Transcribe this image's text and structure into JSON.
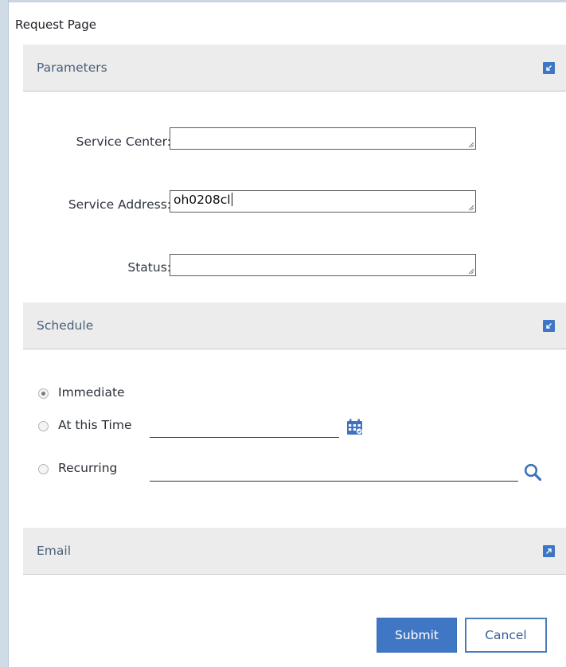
{
  "page": {
    "title": "Request Page"
  },
  "sections": {
    "parameters": {
      "label": "Parameters"
    },
    "schedule": {
      "label": "Schedule"
    },
    "email": {
      "label": "Email"
    }
  },
  "parameters": {
    "service_center_label": "Service Center:",
    "service_center_value": "",
    "service_address_label": "Service Address:",
    "service_address_value": "oh0208cl",
    "status_label": "Status:",
    "status_value": ""
  },
  "schedule": {
    "selected": "Immediate",
    "immediate_label": "Immediate",
    "at_time_label": "At this Time",
    "at_time_value": "",
    "recurring_label": "Recurring",
    "recurring_value": ""
  },
  "icons": {
    "collapse": "collapse-arrow-icon",
    "expand": "expand-arrow-icon",
    "calendar": "calendar-icon",
    "search": "search-icon"
  },
  "colors": {
    "accent": "#4077c4",
    "section_bg": "#ececec",
    "section_text": "#4a5f78"
  },
  "buttons": {
    "submit_label": "Submit",
    "cancel_label": "Cancel"
  }
}
